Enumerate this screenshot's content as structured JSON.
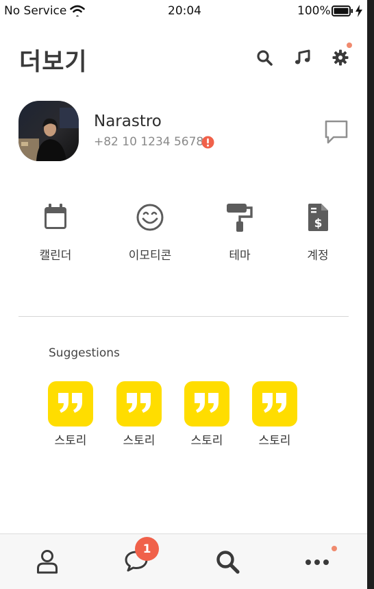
{
  "status_bar": {
    "carrier": "No Service",
    "time": "20:04",
    "battery_percent": "100%"
  },
  "header": {
    "title": "더보기",
    "icons": [
      "search-icon",
      "music-icon",
      "gear-icon"
    ],
    "settings_has_notification": true
  },
  "profile": {
    "name": "Narastro",
    "phone": "+82 10 1234 5678",
    "warning_icon": "exclamation-icon",
    "action_icon": "chat-bubble-icon"
  },
  "quick_menu": [
    {
      "label": "캘린더",
      "icon": "calendar-icon"
    },
    {
      "label": "이모티콘",
      "icon": "smile-icon"
    },
    {
      "label": "테마",
      "icon": "paint-roller-icon"
    },
    {
      "label": "계정",
      "icon": "invoice-dollar-icon"
    }
  ],
  "suggestions": {
    "title": "Suggestions",
    "items": [
      {
        "label": "스토리",
        "icon": "quote-icon"
      },
      {
        "label": "스토리",
        "icon": "quote-icon"
      },
      {
        "label": "스토리",
        "icon": "quote-icon"
      },
      {
        "label": "스토리",
        "icon": "quote-icon"
      }
    ]
  },
  "tab_bar": {
    "tabs": [
      {
        "name": "friends",
        "icon": "person-icon"
      },
      {
        "name": "chats",
        "icon": "chat-icon"
      },
      {
        "name": "search",
        "icon": "search-icon"
      },
      {
        "name": "more",
        "icon": "more-icon"
      }
    ],
    "chat_badge": "1",
    "more_has_notification": true
  },
  "colors": {
    "accent_yellow": "#ffdd00",
    "badge_red": "#f0614a",
    "notification_dot": "#f08a6e",
    "icon_dark": "#3a3a3a"
  }
}
